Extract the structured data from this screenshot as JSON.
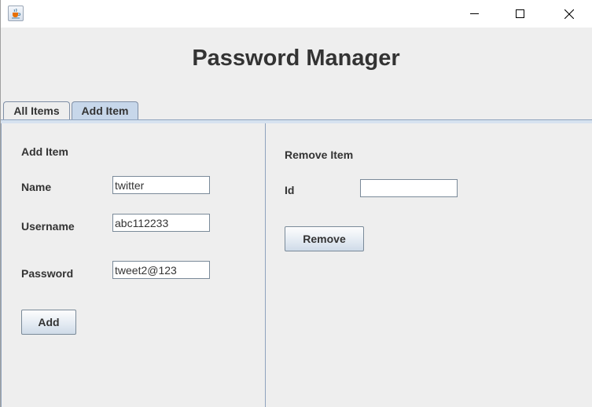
{
  "window": {
    "app_icon": "java-coffee-cup-icon"
  },
  "app": {
    "title": "Password Manager"
  },
  "tabs": [
    {
      "label": "All Items",
      "selected": false
    },
    {
      "label": "Add Item",
      "selected": true
    }
  ],
  "add_panel": {
    "heading": "Add Item",
    "name_label": "Name",
    "name_value": "twitter",
    "username_label": "Username",
    "username_value": "abc112233",
    "password_label": "Password",
    "password_value": "tweet2@123",
    "button_label": "Add"
  },
  "remove_panel": {
    "heading": "Remove Item",
    "id_label": "Id",
    "id_value": "",
    "button_label": "Remove"
  },
  "colors": {
    "selected_tab": "#c7d7ea",
    "panel_bg": "#eeeeee",
    "divider": "#8fa3bd"
  }
}
